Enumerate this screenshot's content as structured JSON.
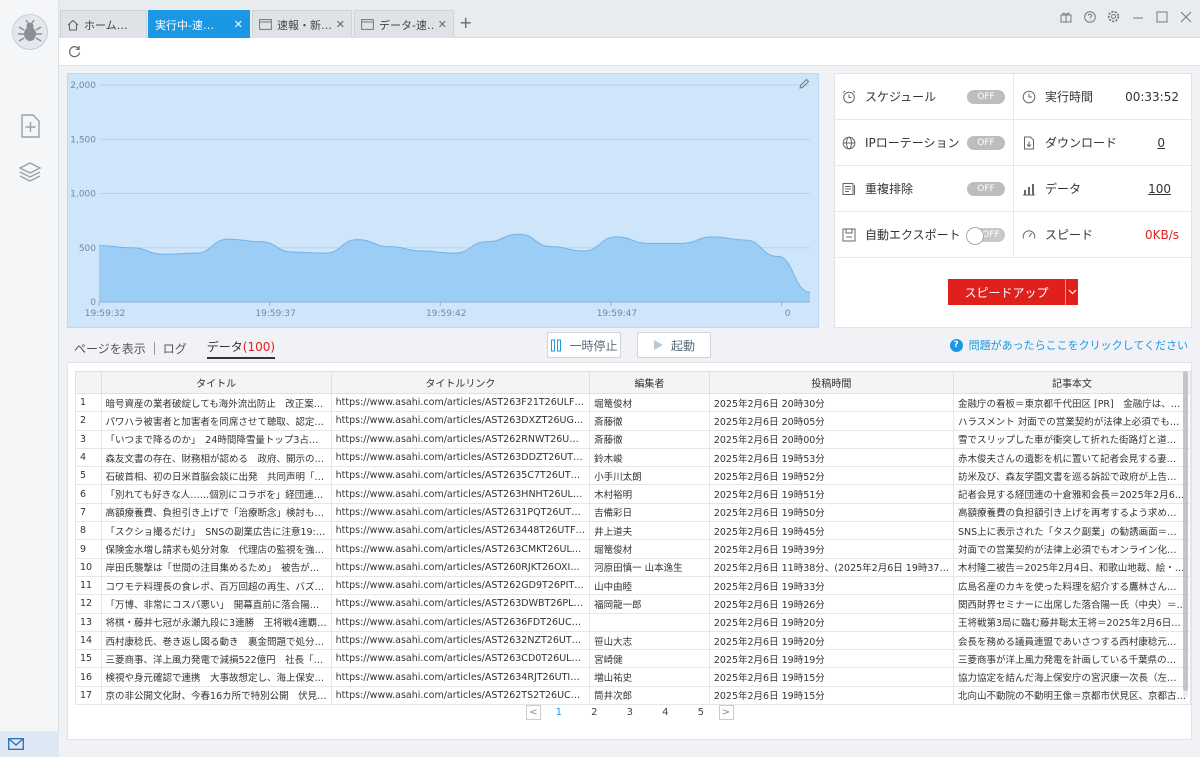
{
  "tabs": [
    {
      "label": "ホーム…",
      "active": false
    },
    {
      "label": "実行中-速…",
      "active": true
    },
    {
      "label": "速報・新…",
      "active": false
    },
    {
      "label": "データ-速…",
      "active": false
    }
  ],
  "chart_data": {
    "type": "area",
    "y_ticks": [
      "2,000",
      "1,500",
      "1,000",
      "500",
      "0"
    ],
    "ylim": [
      0,
      2000
    ],
    "x_ticks": [
      "19:59:32",
      "19:59:37",
      "19:59:42",
      "19:59:47",
      "0"
    ],
    "values": [
      520,
      500,
      440,
      450,
      580,
      555,
      460,
      450,
      575,
      510,
      470,
      450,
      555,
      625,
      510,
      470,
      600,
      540,
      540,
      600,
      570,
      420,
      90
    ],
    "color": "#9ccdf5",
    "line_color": "#6fb4ec"
  },
  "stats": {
    "schedule": {
      "label": "スケジュール",
      "toggle": "OFF"
    },
    "ip_rotation": {
      "label": "IPローテーション",
      "toggle": "OFF"
    },
    "dedupe": {
      "label": "重複排除",
      "toggle": "OFF"
    },
    "auto_export": {
      "label": "自動エクスポート",
      "toggle": "OFF"
    },
    "runtime": {
      "label": "実行時間",
      "value": "00:33:52"
    },
    "download": {
      "label": "ダウンロード",
      "value": "0"
    },
    "data": {
      "label": "データ",
      "value": "100"
    },
    "speed": {
      "label": "スピード",
      "value": "0KB/s"
    }
  },
  "speed_up_label": "スピードアップ",
  "subnav": {
    "page": "ページを表示",
    "log": "ログ",
    "data": "データ",
    "count": "(100)"
  },
  "pause_label": "一時停止",
  "start_label": "起動",
  "help_text": "問題があったらここをクリックしてください",
  "table": {
    "headers": [
      "",
      "タイトル",
      "タイトルリンク",
      "編集者",
      "投稿時間",
      "記事本文"
    ],
    "rows": [
      [
        "1",
        "暗号資産の業者破綻しても海外流出防止　改正案…",
        "https://www.asahi.com/articles/AST263F21T26ULF…",
        "堀篭俊材",
        "2025年2月6日 20時30分",
        "金融庁の看板＝東京都千代田区 [PR]　金融庁は、…"
      ],
      [
        "2",
        "パワハラ被害者と加害者を同席させて聴取、認定…",
        "https://www.asahi.com/articles/AST263DXZT26UG…",
        "斎藤徹",
        "2025年2月6日 20時05分",
        "ハラスメント 対面での営業契約が法律上必須でも…"
      ],
      [
        "3",
        "「いつまで降るのか」　24時間降雪量トップ3占…",
        "https://www.asahi.com/articles/AST262RNWT26U…",
        "斎藤徹",
        "2025年2月6日 20時00分",
        "雪でスリップした車が衝突して折れた街路灯と道…"
      ],
      [
        "4",
        "森友文書の存在、財務相が認める　政府、開示の…",
        "https://www.asahi.com/articles/AST263DDZT26UT…",
        "鈴木峻",
        "2025年2月6日 19時53分",
        "赤木俊夫さんの遺影を机に置いて記者会見する妻…"
      ],
      [
        "5",
        "石破首相、初の日米首脳会談に出発　共同声明「…",
        "https://www.asahi.com/articles/AST2635C7T26UT…",
        "小手川太朗",
        "2025年2月6日 19時52分",
        "訪米及び、森友学園文書を巡る訴訟で政府が上告…"
      ],
      [
        "6",
        "「別れても好きな人……個別にコラボを」経団連…",
        "https://www.asahi.com/articles/AST263HNHT26UL…",
        "木村裕明",
        "2025年2月6日 19時51分",
        "記者会見する経団連の十倉雅和会長＝2025年2月6…"
      ],
      [
        "7",
        "高額療養費、負担引き上げで「治療断念」検討も…",
        "https://www.asahi.com/articles/AST2631PQT26UT…",
        "吉備彩日",
        "2025年2月6日 19時50分",
        "高額療養費の負担額引き上げを再考するよう求め…"
      ],
      [
        "8",
        "「スクショ撮るだけ」　SNSの副業広告に注意19:…",
        "https://www.asahi.com/articles/AST263448T26UTF…",
        "井上道夫",
        "2025年2月6日 19時45分",
        "SNS上に表示された「タスク副業」の勧誘画面＝…"
      ],
      [
        "9",
        "保険金水増し請求も処分対象　代理店の監視を強…",
        "https://www.asahi.com/articles/AST263CMKT26UL…",
        "堀篭俊材",
        "2025年2月6日 19時39分",
        "対面での営業契約が法律上必須でもオンライン化…"
      ],
      [
        "10",
        "岸田氏襲撃は「世間の注目集めるため」　被告が…",
        "https://www.asahi.com/articles/AST260RJKT26OXI…",
        "河原田慎一 山本逸生",
        "2025年2月6日 11時38分、(2025年2月6日 19時37…",
        "木村隆二被告＝2025年2月4日、和歌山地裁、絵・…"
      ],
      [
        "11",
        "コワモテ料理長の食レポ、百万回超の再生、バズ…",
        "https://www.asahi.com/articles/AST262GD9T26PIT…",
        "山中由睦",
        "2025年2月6日 19時33分",
        "広島名産のカキを使った料理を紹介する鷹林さん…"
      ],
      [
        "12",
        "「万博、非常にコスパ悪い」　開幕直前に落合陽…",
        "https://www.asahi.com/articles/AST263DWBT26PL…",
        "福岡龍一郎",
        "2025年2月6日 19時26分",
        "関西財界セミナーに出席した落合陽一氏（中央）＝…"
      ],
      [
        "13",
        "将棋・藤井七冠が永瀬九段に3連勝　王将戦4連覇…",
        "https://www.asahi.com/articles/AST2636FDT26UC…",
        "",
        "2025年2月6日 19時20分",
        "王将戦第3局に臨む藤井聡太王将＝2025年2月6日…"
      ],
      [
        "14",
        "西村康稔氏、巻き返し図る動き　裏金問題で処分…",
        "https://www.asahi.com/articles/AST2632NZT26UT…",
        "笹山大志",
        "2025年2月6日 19時20分",
        "会長を務める議員連盟であいさつする西村康稔元…"
      ],
      [
        "15",
        "三菱商事、洋上風力発電で減損522億円　社長「…",
        "https://www.asahi.com/articles/AST263CD0T26UL…",
        "宮崎健",
        "2025年2月6日 19時19分",
        "三菱商事が洋上風力発電を計画している千葉県の…"
      ],
      [
        "16",
        "検視や身元確認で連携　大事故想定し、海上保安…",
        "https://www.asahi.com/articles/AST2634RJT26UTI…",
        "増山祐史",
        "2025年2月6日 19時15分",
        "協力協定を結んだ海上保安庁の宮沢康一次長（左…"
      ],
      [
        "17",
        "京の非公開文化財、今春16カ所で特別公開　伏見…",
        "https://www.asahi.com/articles/AST262TS2T26UC…",
        "筒井次郎",
        "2025年2月6日 19時15分",
        "北向山不動院の不動明王像＝京都市伏見区、京都古…"
      ]
    ]
  },
  "pager": {
    "prev": "<",
    "pages": [
      "1",
      "2",
      "3",
      "4",
      "5"
    ],
    "next": ">"
  }
}
